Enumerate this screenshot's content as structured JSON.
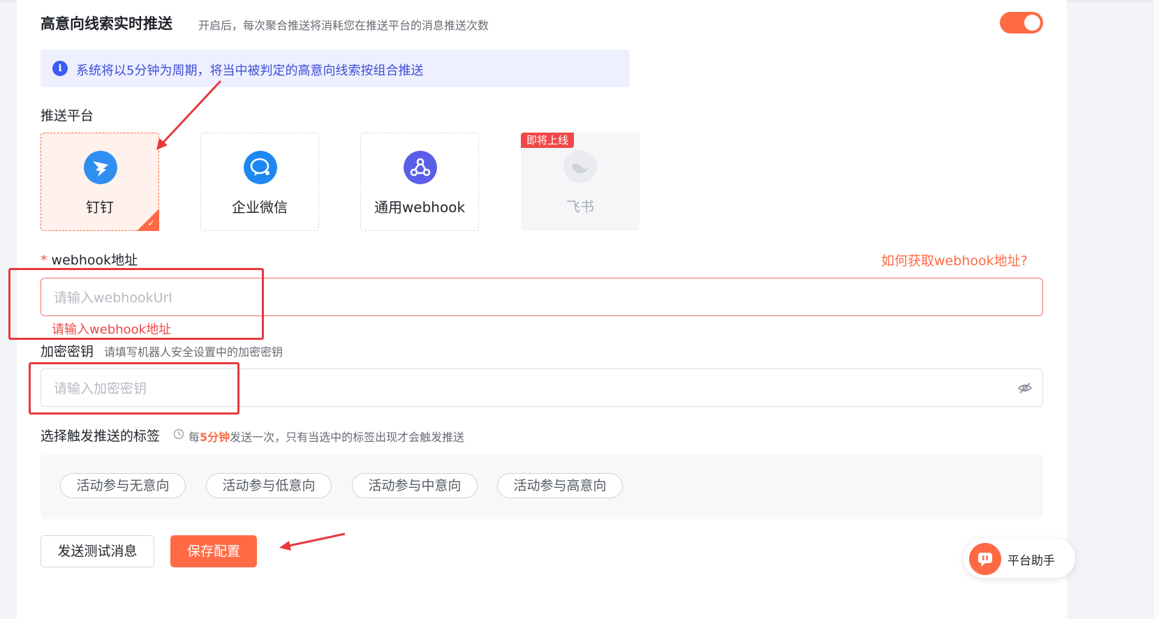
{
  "header": {
    "title": "高意向线索实时推送",
    "subtitle": "开启后，每次聚合推送将消耗您在推送平台的消息推送次数",
    "toggle_on": true
  },
  "info_banner": {
    "icon": "i",
    "text": "系统将以5分钟为周期，将当中被判定的高意向线索按组合推送"
  },
  "platform": {
    "label": "推送平台",
    "options": [
      {
        "name": "钉钉",
        "icon": "dingtalk-icon",
        "selected": true
      },
      {
        "name": "企业微信",
        "icon": "wecom-icon",
        "selected": false
      },
      {
        "name": "通用webhook",
        "icon": "webhook-icon",
        "selected": false
      },
      {
        "name": "飞书",
        "icon": "feishu-icon",
        "selected": false,
        "badge": "即将上线"
      }
    ]
  },
  "webhook": {
    "required_mark": "*",
    "label": "webhook地址",
    "help_link": "如何获取webhook地址?",
    "placeholder": "请输入webhookUrl",
    "error": "请输入webhook地址"
  },
  "secret": {
    "label": "加密密钥",
    "hint": "请填写机器人安全设置中的加密密钥",
    "placeholder": "请输入加密密钥"
  },
  "tags": {
    "label": "选择触发推送的标签",
    "hint_prefix": "每",
    "hint_highlight": "5分钟",
    "hint_suffix": "发送一次，只有当选中的标签出现才会触发推送",
    "items": [
      "活动参与无意向",
      "活动参与低意向",
      "活动参与中意向",
      "活动参与高意向"
    ]
  },
  "actions": {
    "test_label": "发送测试消息",
    "save_label": "保存配置"
  },
  "assistant": {
    "label": "平台助手"
  },
  "colors": {
    "accent": "#ff6a45",
    "info_bg": "#eef0ff",
    "info_text": "#3d4ed8",
    "error": "#f04848",
    "annotation": "#e8383d"
  }
}
